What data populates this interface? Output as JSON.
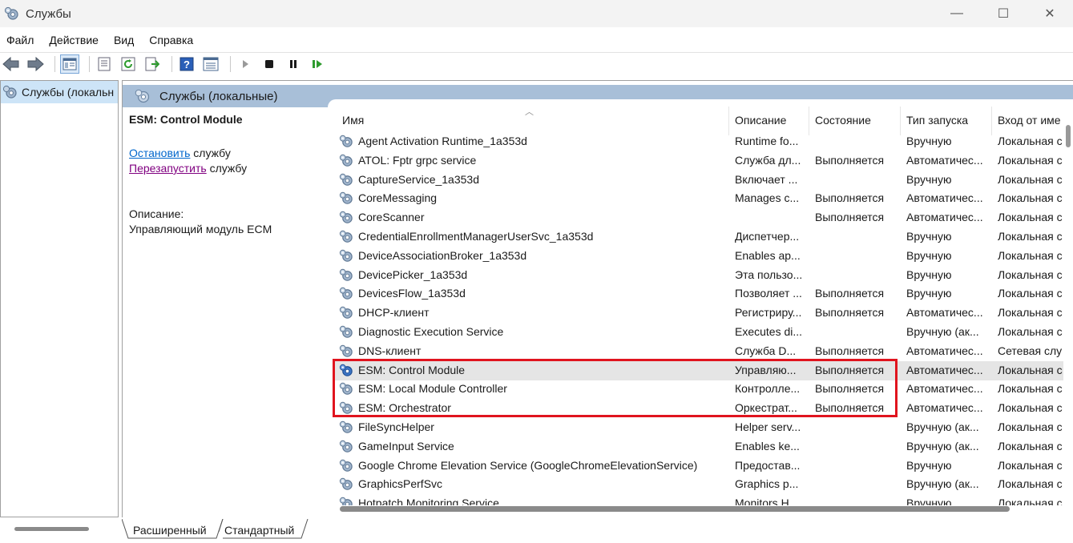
{
  "window": {
    "title": "Службы",
    "icon": "gear-icon",
    "controls": {
      "minimize": "—",
      "maximize": "☐",
      "close": "✕"
    }
  },
  "menu": [
    "Файл",
    "Действие",
    "Вид",
    "Справка"
  ],
  "toolbar_icons": [
    "back-arrow-icon",
    "forward-arrow-icon",
    "console-tree-icon",
    "properties-icon",
    "refresh-icon",
    "export-list-icon",
    "help-icon",
    "details-view-icon",
    "start-service-icon",
    "stop-service-icon",
    "pause-service-icon",
    "resume-service-icon"
  ],
  "tree": {
    "root_label": "Службы (локальн"
  },
  "panel": {
    "title": "Службы (локальные)",
    "selected_service": "ESM: Control Module",
    "stop_link": "Остановить",
    "restart_link": "Перезапустить",
    "link_suffix": " службу",
    "description_label": "Описание:",
    "description_text": "Управляющий модуль ECM"
  },
  "columns": [
    "Имя",
    "Описание",
    "Состояние",
    "Тип запуска",
    "Вход от име"
  ],
  "rows": [
    {
      "name": "Agent Activation Runtime_1a353d",
      "desc": "Runtime fo...",
      "state": "",
      "start": "Вручную",
      "logon": "Локальная с"
    },
    {
      "name": "ATOL: Fptr grpc service",
      "desc": "Служба дл...",
      "state": "Выполняется",
      "start": "Автоматичес...",
      "logon": "Локальная с"
    },
    {
      "name": "CaptureService_1a353d",
      "desc": "Включает ...",
      "state": "",
      "start": "Вручную",
      "logon": "Локальная с"
    },
    {
      "name": "CoreMessaging",
      "desc": "Manages c...",
      "state": "Выполняется",
      "start": "Автоматичес...",
      "logon": "Локальная с"
    },
    {
      "name": "CoreScanner",
      "desc": "",
      "state": "Выполняется",
      "start": "Автоматичес...",
      "logon": "Локальная с"
    },
    {
      "name": "CredentialEnrollmentManagerUserSvc_1a353d",
      "desc": "Диспетчер...",
      "state": "",
      "start": "Вручную",
      "logon": "Локальная с"
    },
    {
      "name": "DeviceAssociationBroker_1a353d",
      "desc": "Enables ap...",
      "state": "",
      "start": "Вручную",
      "logon": "Локальная с"
    },
    {
      "name": "DevicePicker_1a353d",
      "desc": "Эта пользо...",
      "state": "",
      "start": "Вручную",
      "logon": "Локальная с"
    },
    {
      "name": "DevicesFlow_1a353d",
      "desc": "Позволяет ...",
      "state": "Выполняется",
      "start": "Вручную",
      "logon": "Локальная с"
    },
    {
      "name": "DHCP-клиент",
      "desc": "Регистриру...",
      "state": "Выполняется",
      "start": "Автоматичес...",
      "logon": "Локальная с"
    },
    {
      "name": "Diagnostic Execution Service",
      "desc": "Executes di...",
      "state": "",
      "start": "Вручную (ак...",
      "logon": "Локальная с"
    },
    {
      "name": "DNS-клиент",
      "desc": "Служба D...",
      "state": "Выполняется",
      "start": "Автоматичес...",
      "logon": "Сетевая слу"
    },
    {
      "name": "ESM: Control Module",
      "desc": "Управляю...",
      "state": "Выполняется",
      "start": "Автоматичес...",
      "logon": "Локальная с"
    },
    {
      "name": "ESM: Local Module Controller",
      "desc": "Контролле...",
      "state": "Выполняется",
      "start": "Автоматичес...",
      "logon": "Локальная с"
    },
    {
      "name": "ESM: Orchestrator",
      "desc": "Оркестрат...",
      "state": "Выполняется",
      "start": "Автоматичес...",
      "logon": "Локальная с"
    },
    {
      "name": "FileSyncHelper",
      "desc": "Helper serv...",
      "state": "",
      "start": "Вручную (ак...",
      "logon": "Локальная с"
    },
    {
      "name": "GameInput Service",
      "desc": "Enables ke...",
      "state": "",
      "start": "Вручную (ак...",
      "logon": "Локальная с"
    },
    {
      "name": "Google Chrome Elevation Service (GoogleChromeElevationService)",
      "desc": "Предостав...",
      "state": "",
      "start": "Вручную",
      "logon": "Локальная с"
    },
    {
      "name": "GraphicsPerfSvc",
      "desc": "Graphics p...",
      "state": "",
      "start": "Вручную (ак...",
      "logon": "Локальная с"
    },
    {
      "name": "Hotpatch Monitoring Service",
      "desc": "Monitors H...",
      "state": "",
      "start": "Вручную",
      "logon": "Локальная с"
    }
  ],
  "selected_row_index": 12,
  "highlight_color": "#e0141e",
  "bottom_tabs": [
    "Расширенный",
    "Стандартный"
  ]
}
